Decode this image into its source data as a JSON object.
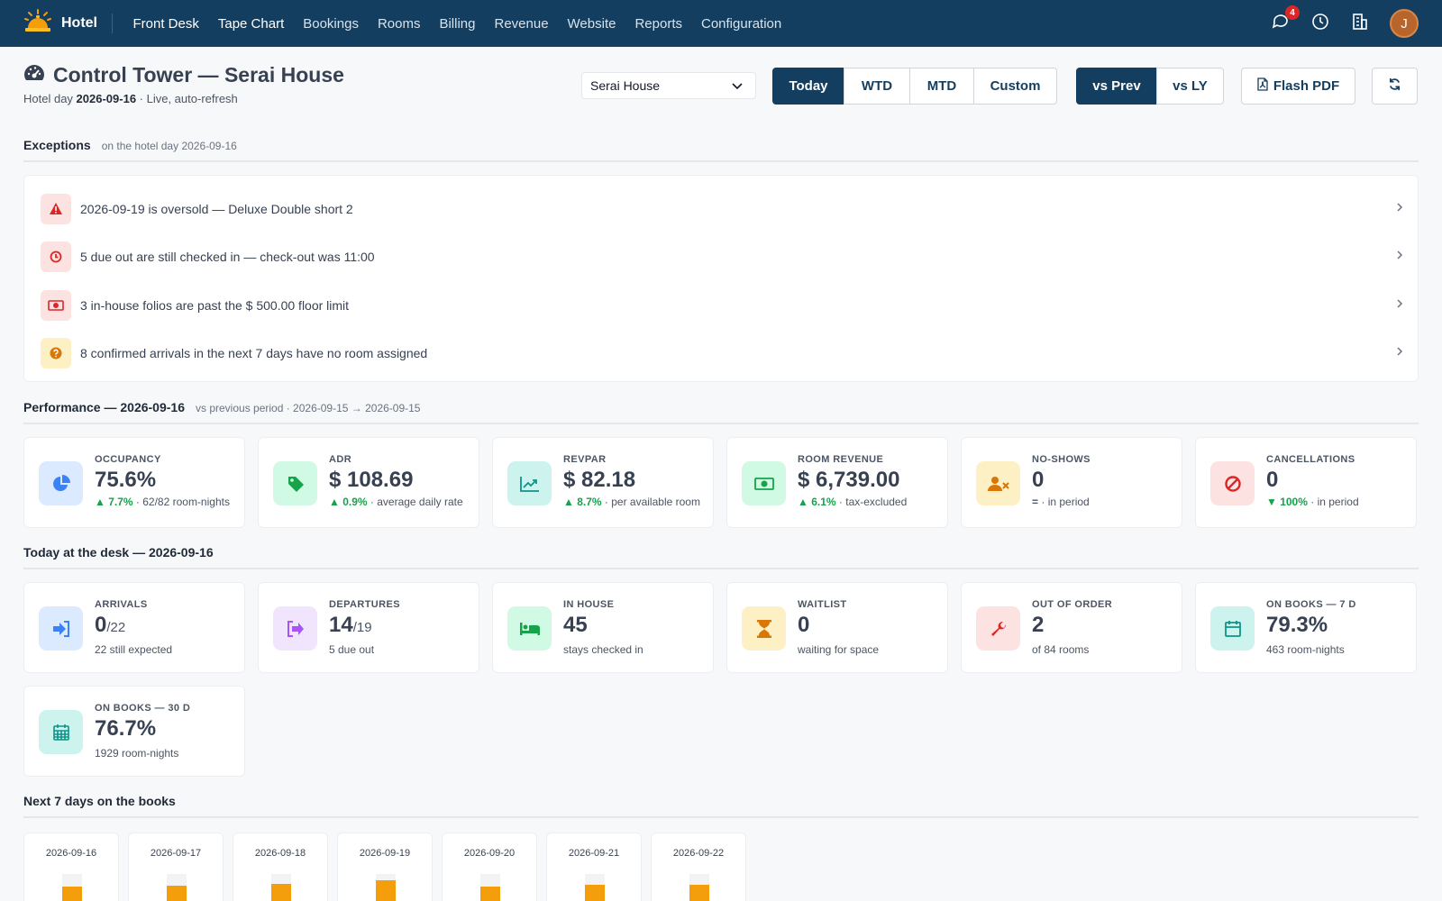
{
  "nav": {
    "brand": "Hotel",
    "menu": [
      {
        "label": "Front Desk"
      },
      {
        "label": "Tape Chart"
      },
      {
        "label": "Bookings"
      },
      {
        "label": "Rooms"
      },
      {
        "label": "Billing"
      },
      {
        "label": "Revenue"
      },
      {
        "label": "Website"
      },
      {
        "label": "Reports"
      },
      {
        "label": "Configuration"
      }
    ],
    "notifications_count": "4",
    "user_initial": "J"
  },
  "header": {
    "title": "Control Tower — Serai House",
    "subtitle_prefix": "Hotel day",
    "hotel_day": "2026-09-16",
    "subtitle_suffix": "· Live, auto-refresh",
    "property_selected": "Serai House"
  },
  "period_buttons": [
    {
      "label": "Today",
      "active": true
    },
    {
      "label": "WTD",
      "active": false
    },
    {
      "label": "MTD",
      "active": false
    },
    {
      "label": "Custom",
      "active": false
    }
  ],
  "compare_buttons": [
    {
      "label": "vs Prev",
      "active": true
    },
    {
      "label": "vs LY",
      "active": false
    }
  ],
  "flash_pdf_label": "Flash PDF",
  "exceptions": {
    "title": "Exceptions",
    "subtitle": "on the hotel day 2026-09-16",
    "items": [
      {
        "text": "2026-09-19 is oversold — Deluxe Double short 2",
        "icon": "warning-icon",
        "color": "#dc2626",
        "bg": "#fde2e2"
      },
      {
        "text": "5 due out are still checked in — check-out was 11:00",
        "icon": "clock-icon",
        "color": "#dc2626",
        "bg": "#fde2e2"
      },
      {
        "text": "3 in-house folios are past the $ 500.00 floor limit",
        "icon": "money-icon",
        "color": "#dc2626",
        "bg": "#fde2e2"
      },
      {
        "text": "8 confirmed arrivals in the next 7 days have no room assigned",
        "icon": "question-icon",
        "color": "#d97706",
        "bg": "#fdf0c4"
      }
    ]
  },
  "performance": {
    "title": "Performance — 2026-09-16",
    "subtitle": "vs previous period · 2026-09-15 → 2026-09-15",
    "cards": [
      {
        "label": "OCCUPANCY",
        "value": "75.6%",
        "delta": "▲ 7.7%",
        "note": "· 62/82 room-nights",
        "icon": "pie-chart-icon",
        "color": "#3b82f6",
        "bg": "#dbeafe"
      },
      {
        "label": "ADR",
        "value": "$ 108.69",
        "delta": "▲ 0.9%",
        "note": "· average daily rate",
        "icon": "tag-icon",
        "color": "#16a34a",
        "bg": "#d1fae5"
      },
      {
        "label": "REVPAR",
        "value": "$ 82.18",
        "delta": "▲ 8.7%",
        "note": "· per available room",
        "icon": "trend-chart-icon",
        "color": "#0d9488",
        "bg": "#ccf3ee"
      },
      {
        "label": "ROOM REVENUE",
        "value": "$ 6,739.00",
        "delta": "▲ 6.1%",
        "note": "· tax-excluded",
        "icon": "money-icon",
        "color": "#16a34a",
        "bg": "#d1fae5"
      },
      {
        "label": "NO-SHOWS",
        "value": "0",
        "delta": "=",
        "note": "· in period",
        "icon": "user-x-icon",
        "color": "#d97706",
        "bg": "#fdf0c4"
      },
      {
        "label": "CANCELLATIONS",
        "value": "0",
        "delta": "▼ 100%",
        "note": "· in period",
        "icon": "ban-icon",
        "color": "#dc2626",
        "bg": "#fde2e2"
      }
    ]
  },
  "desk": {
    "title": "Today at the desk — 2026-09-16",
    "cards": [
      {
        "label": "ARRIVALS",
        "value": "0",
        "total": "/22",
        "note": "22 still expected",
        "icon": "sign-in-icon",
        "color": "#3b82f6",
        "bg": "#dbeafe"
      },
      {
        "label": "DEPARTURES",
        "value": "14",
        "total": "/19",
        "note": "5 due out",
        "icon": "sign-out-icon",
        "color": "#a855f7",
        "bg": "#f1e4fd"
      },
      {
        "label": "IN HOUSE",
        "value": "45",
        "total": "",
        "note": "stays checked in",
        "icon": "bed-icon",
        "color": "#16a34a",
        "bg": "#d1fae5"
      },
      {
        "label": "WAITLIST",
        "value": "0",
        "total": "",
        "note": "waiting for space",
        "icon": "hourglass-icon",
        "color": "#d97706",
        "bg": "#fdf0c4"
      },
      {
        "label": "OUT OF ORDER",
        "value": "2",
        "total": "",
        "note": "of 84 rooms",
        "icon": "wrench-icon",
        "color": "#dc2626",
        "bg": "#fde2e2"
      },
      {
        "label": "ON BOOKS — 7 D",
        "value": "79.3%",
        "total": "",
        "note": "463 room-nights",
        "icon": "calendar-icon",
        "color": "#0d9488",
        "bg": "#ccf3ee"
      },
      {
        "label": "ON BOOKS — 30 D",
        "value": "76.7%",
        "total": "",
        "note": "1929 room-nights",
        "icon": "calendar-grid-icon",
        "color": "#0d9488",
        "bg": "#ccf3ee"
      }
    ]
  },
  "next7": {
    "title": "Next 7 days on the books",
    "days": [
      {
        "date": "2026-09-16",
        "occupancy_pct": 76
      },
      {
        "date": "2026-09-17",
        "occupancy_pct": 78
      },
      {
        "date": "2026-09-18",
        "occupancy_pct": 82
      },
      {
        "date": "2026-09-19",
        "occupancy_pct": 88
      },
      {
        "date": "2026-09-20",
        "occupancy_pct": 76
      },
      {
        "date": "2026-09-21",
        "occupancy_pct": 80
      },
      {
        "date": "2026-09-22",
        "occupancy_pct": 80
      }
    ]
  }
}
